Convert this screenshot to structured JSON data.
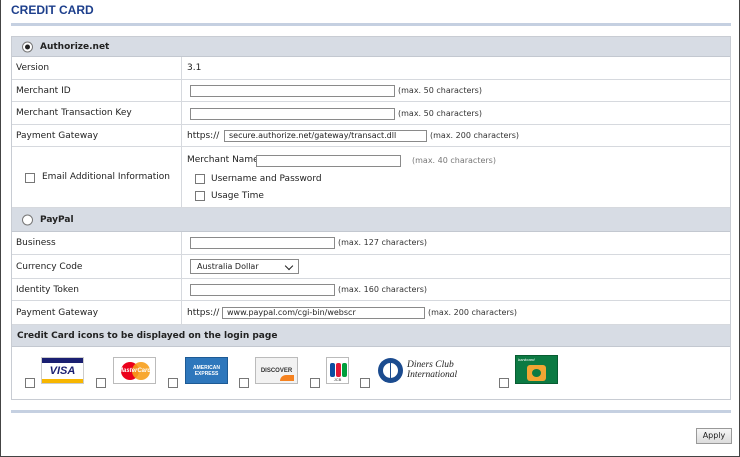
{
  "title": "CREDIT CARD",
  "authorize": {
    "heading": "Authorize.net",
    "version_label": "Version",
    "version_value": "3.1",
    "merchant_id_label": "Merchant ID",
    "merchant_id_value": "",
    "merchant_id_hint": "(max. 50 characters)",
    "txn_key_label": "Merchant Transaction Key",
    "txn_key_value": "",
    "txn_key_hint": "(max. 50 characters)",
    "gateway_label": "Payment Gateway",
    "gateway_prefix": "https://",
    "gateway_value": "secure.authorize.net/gateway/transact.dll",
    "gateway_hint": "(max. 200 characters)",
    "email_label": "Email Additional Information",
    "merchant_name_label": "Merchant Name:",
    "merchant_name_value": "",
    "merchant_name_hint": "(max. 40 characters)",
    "username_password_label": "Username and Password",
    "usage_time_label": "Usage Time"
  },
  "paypal": {
    "heading": "PayPal",
    "business_label": "Business",
    "business_value": "",
    "business_hint": "(max. 127 characters)",
    "currency_label": "Currency Code",
    "currency_value": "Australia Dollar",
    "identity_label": "Identity Token",
    "identity_value": "",
    "identity_hint": "(max. 160 characters)",
    "gateway_label": "Payment Gateway",
    "gateway_prefix": "https://",
    "gateway_value": "www.paypal.com/cgi-bin/webscr",
    "gateway_hint": "(max. 200 characters)"
  },
  "icons_section": {
    "heading": "Credit Card icons to be displayed on the login page",
    "cards": [
      {
        "name": "VISA",
        "icon": "visa-logo"
      },
      {
        "name": "MasterCard",
        "icon": "mastercard-logo"
      },
      {
        "name": "AMERICAN EXPRESS",
        "icon": "amex-logo"
      },
      {
        "name": "DISCOVER",
        "icon": "discover-logo"
      },
      {
        "name": "JCB",
        "icon": "jcb-logo"
      },
      {
        "name": "Diners Club International",
        "icon": "diners-logo"
      },
      {
        "name": "bankcard",
        "icon": "bankcard-logo"
      }
    ]
  },
  "apply_label": "Apply",
  "colors": {
    "title": "#1d3f8c",
    "section_bg": "#d7dce4",
    "rule": "#c5d0e1"
  }
}
